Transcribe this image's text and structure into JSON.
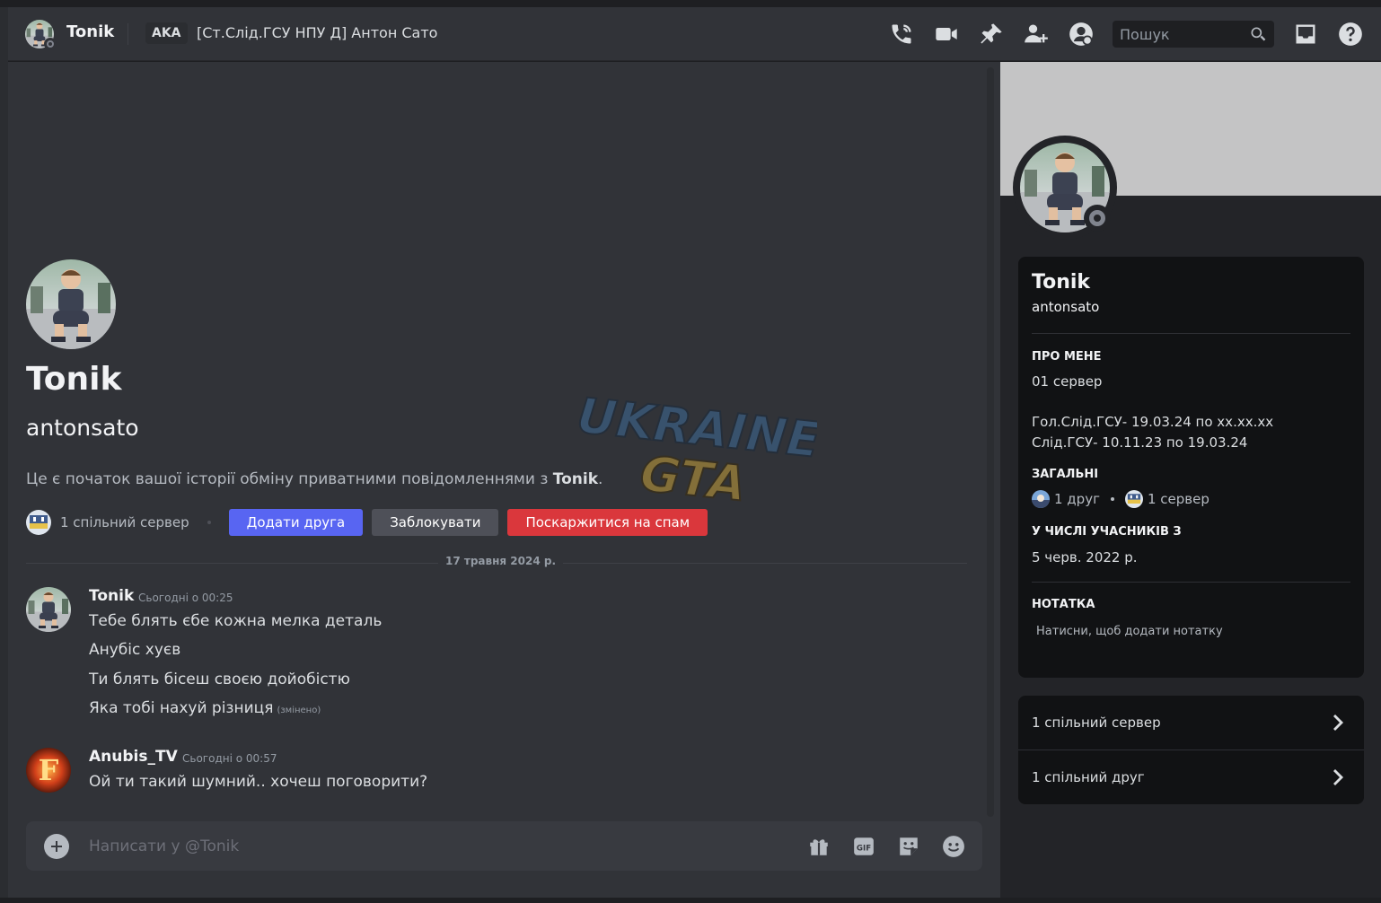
{
  "header": {
    "name": "Tonik",
    "aka_label": "AKA",
    "nickname": "[Ст.Слід.ГСУ НПУ Д] Антон Сато",
    "search_placeholder": "Пошук",
    "icons": [
      "phone-call-icon",
      "video-call-icon",
      "pin-icon",
      "add-friend-icon",
      "profile-toggle-icon",
      "search-icon",
      "inbox-icon",
      "help-icon"
    ]
  },
  "intro": {
    "name": "Tonik",
    "username": "antonsato",
    "text_before": "Це є початок вашої історії обміну приватними повідомленнями з ",
    "text_name": "Tonik",
    "text_after": ".",
    "mutual_servers": "1 спільний сервер",
    "add_friend": "Додати друга",
    "block": "Заблокувати",
    "report_spam": "Поскаржитися на спам"
  },
  "date_divider": "17 травня 2024 р.",
  "messages": [
    {
      "author": "Tonik",
      "time": "Сьогодні о 00:25",
      "lines": [
        "Тебе блять єбе кожна мелка деталь",
        "Анубіс хуєв",
        "Ти блять бісеш своєю дойобістю",
        "Яка тобі нахуй різниця"
      ],
      "edited": "(змінено)"
    },
    {
      "author": "Anubis_TV",
      "time": "Сьогодні о 00:57",
      "lines": [
        "Ой ти такий шумний.. хочеш поговорити?"
      ]
    }
  ],
  "composer": {
    "placeholder": "Написати у @Tonik",
    "icons": [
      "add-attachment-icon",
      "gift-icon",
      "gif-icon",
      "sticker-icon",
      "emoji-icon"
    ]
  },
  "watermark": {
    "line1": "UKRAINE",
    "line2": "GTA"
  },
  "profile": {
    "name": "Tonik",
    "username": "antonsato",
    "about_heading": "ПРО МЕНЕ",
    "about_line1": "01 сервер",
    "about_line2": "Гол.Слід.ГСУ- 19.03.24 по хх.хх.хх",
    "about_line3": "Слід.ГСУ- 10.11.23 по 19.03.24",
    "common_heading": "ЗАГАЛЬНІ",
    "common_friends": "1 друг",
    "common_servers": "1 сервер",
    "member_since_heading": "У ЧИСЛІ УЧАСНИКІВ З",
    "member_since": "5 черв. 2022 р.",
    "note_heading": "НОТАТКА",
    "note_placeholder": "Натисни, щоб додати нотатку"
  },
  "mutuals": {
    "servers": "1 спільний сервер",
    "friends": "1 спільний друг"
  },
  "colors": {
    "blurple": "#5865f2",
    "danger": "#da373c",
    "secondary": "#4e5058",
    "banner": "#c4c4c5"
  }
}
